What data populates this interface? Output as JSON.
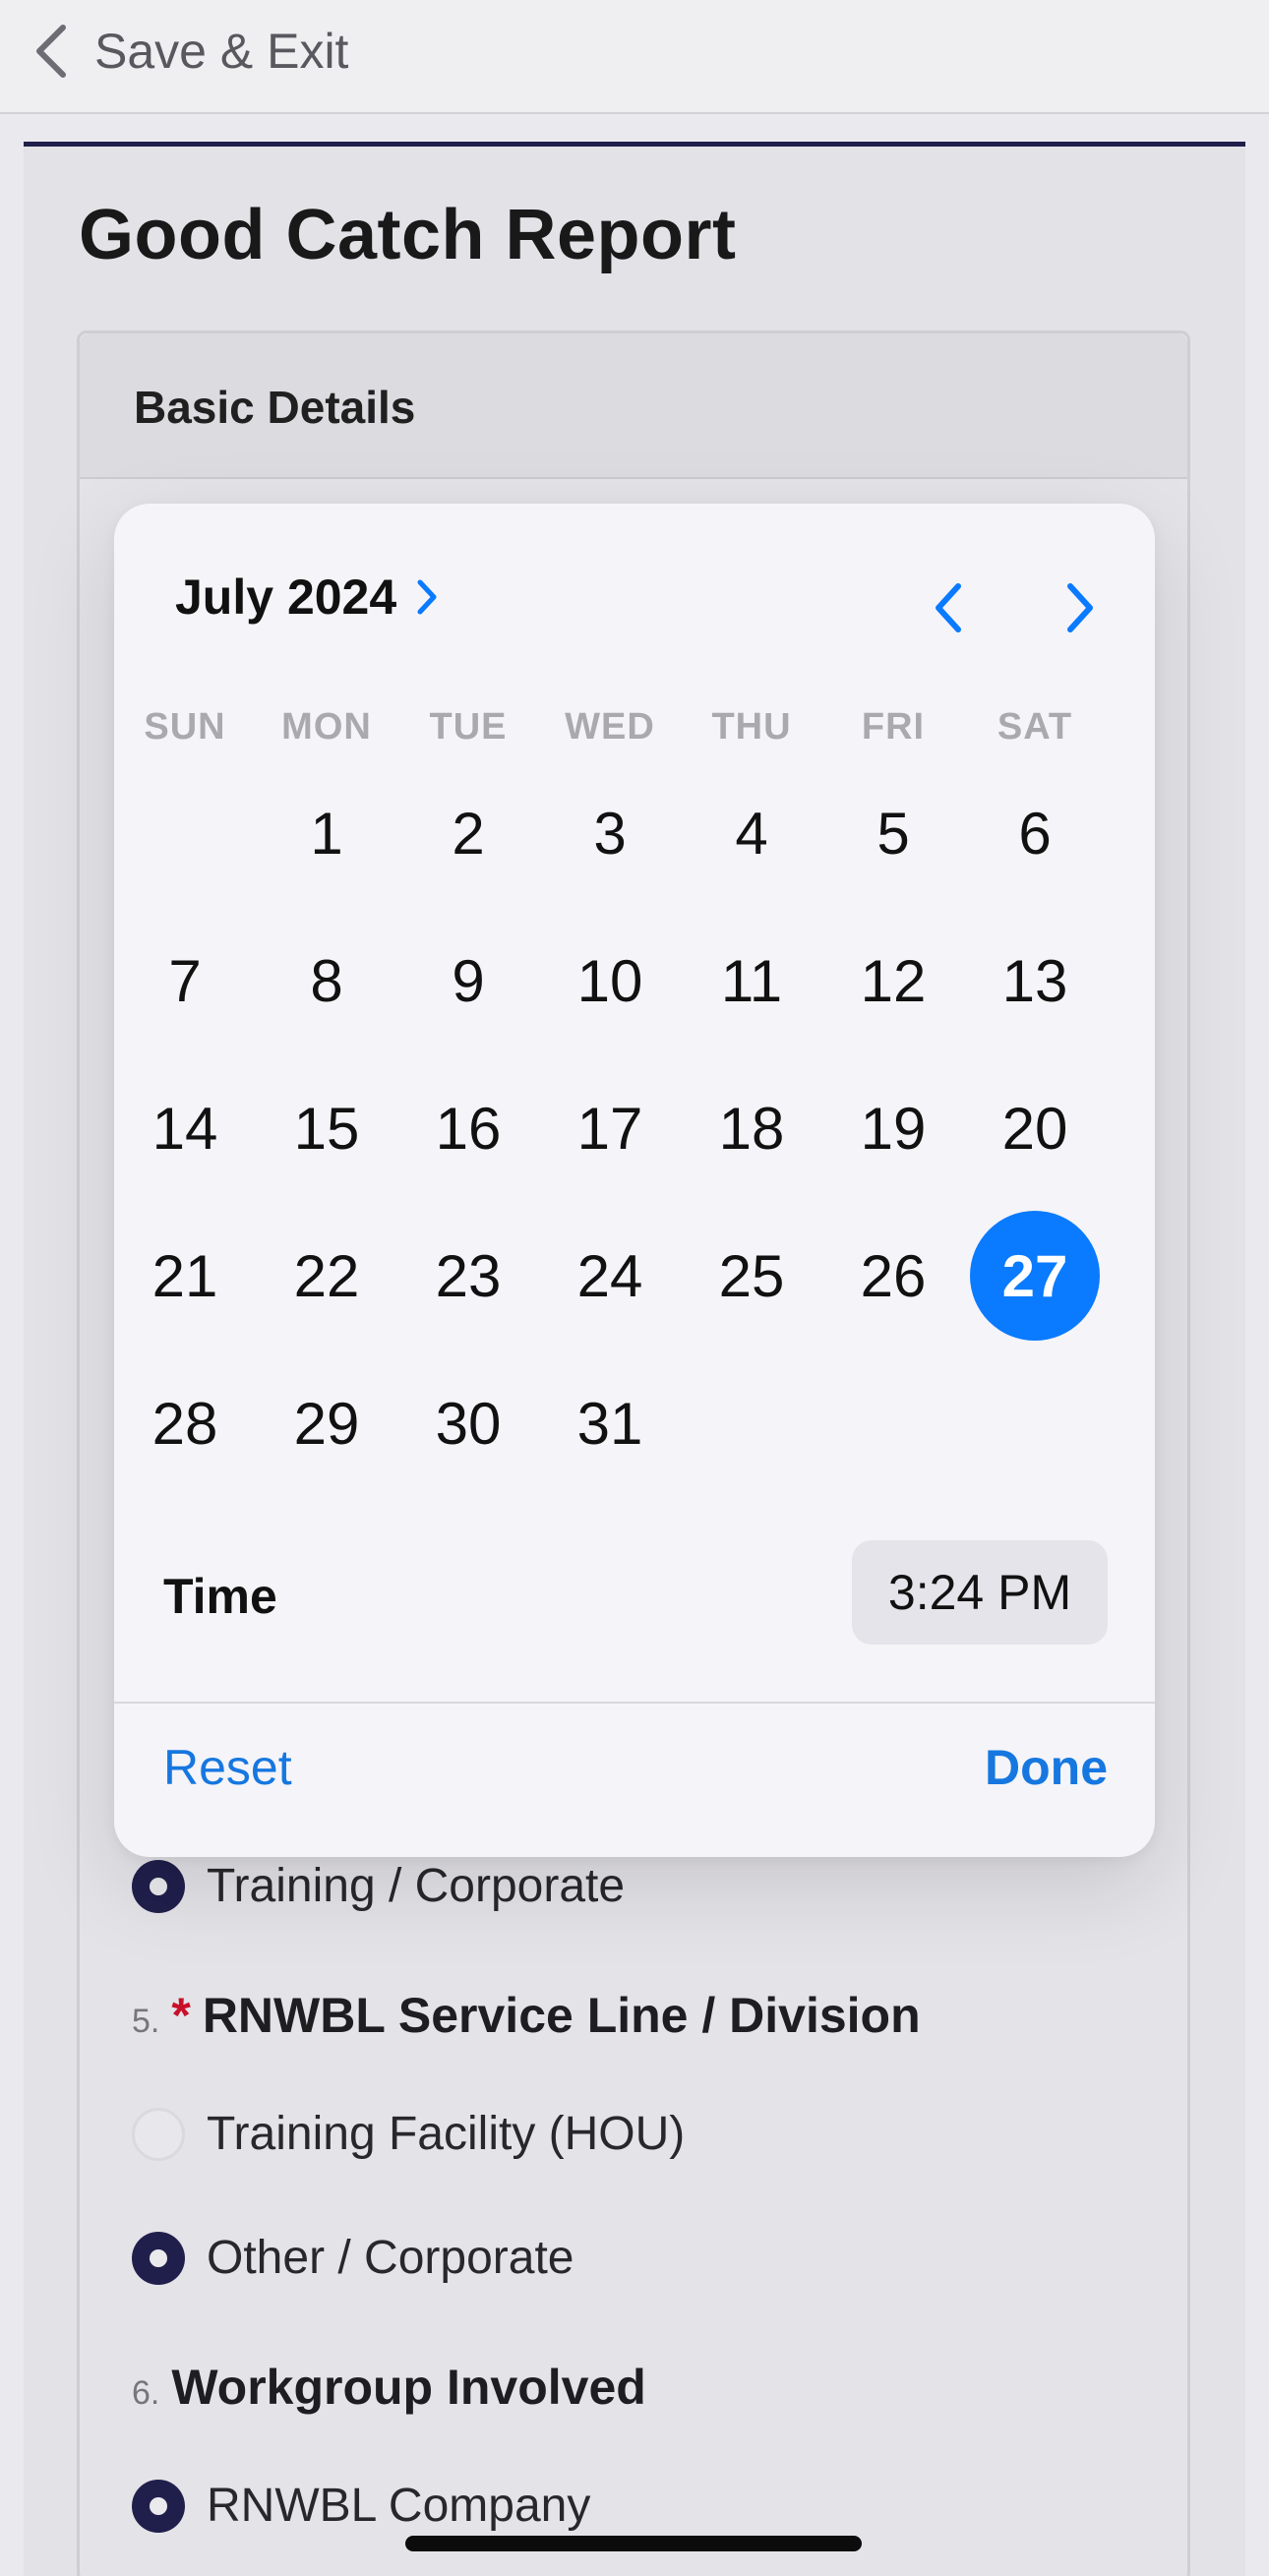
{
  "nav": {
    "back_label": "Save & Exit"
  },
  "page": {
    "title": "Good Catch Report"
  },
  "card": {
    "header": "Basic Details"
  },
  "form": {
    "option_training_corporate": "Training / Corporate",
    "q5": {
      "number": "5.",
      "required_mark": "*",
      "label": "RNWBL Service Line / Division"
    },
    "option_training_facility": "Training Facility (HOU)",
    "option_other_corporate": "Other / Corporate",
    "q6": {
      "number": "6.",
      "label": "Workgroup Involved"
    },
    "option_rnwbl_company": "RNWBL Company"
  },
  "date_picker": {
    "month_label": "July 2024",
    "weekdays": [
      "SUN",
      "MON",
      "TUE",
      "WED",
      "THU",
      "FRI",
      "SAT"
    ],
    "first_weekday_index": 1,
    "days_in_month": 31,
    "selected_day": 27,
    "time_label": "Time",
    "time_value": "3:24 PM",
    "reset_label": "Reset",
    "done_label": "Done",
    "accent_color": "#0a7aff"
  },
  "icons": {
    "back": "chevron-left-icon",
    "month_expand": "chevron-right-icon",
    "prev_month": "chevron-left-icon",
    "next_month": "chevron-right-icon"
  }
}
